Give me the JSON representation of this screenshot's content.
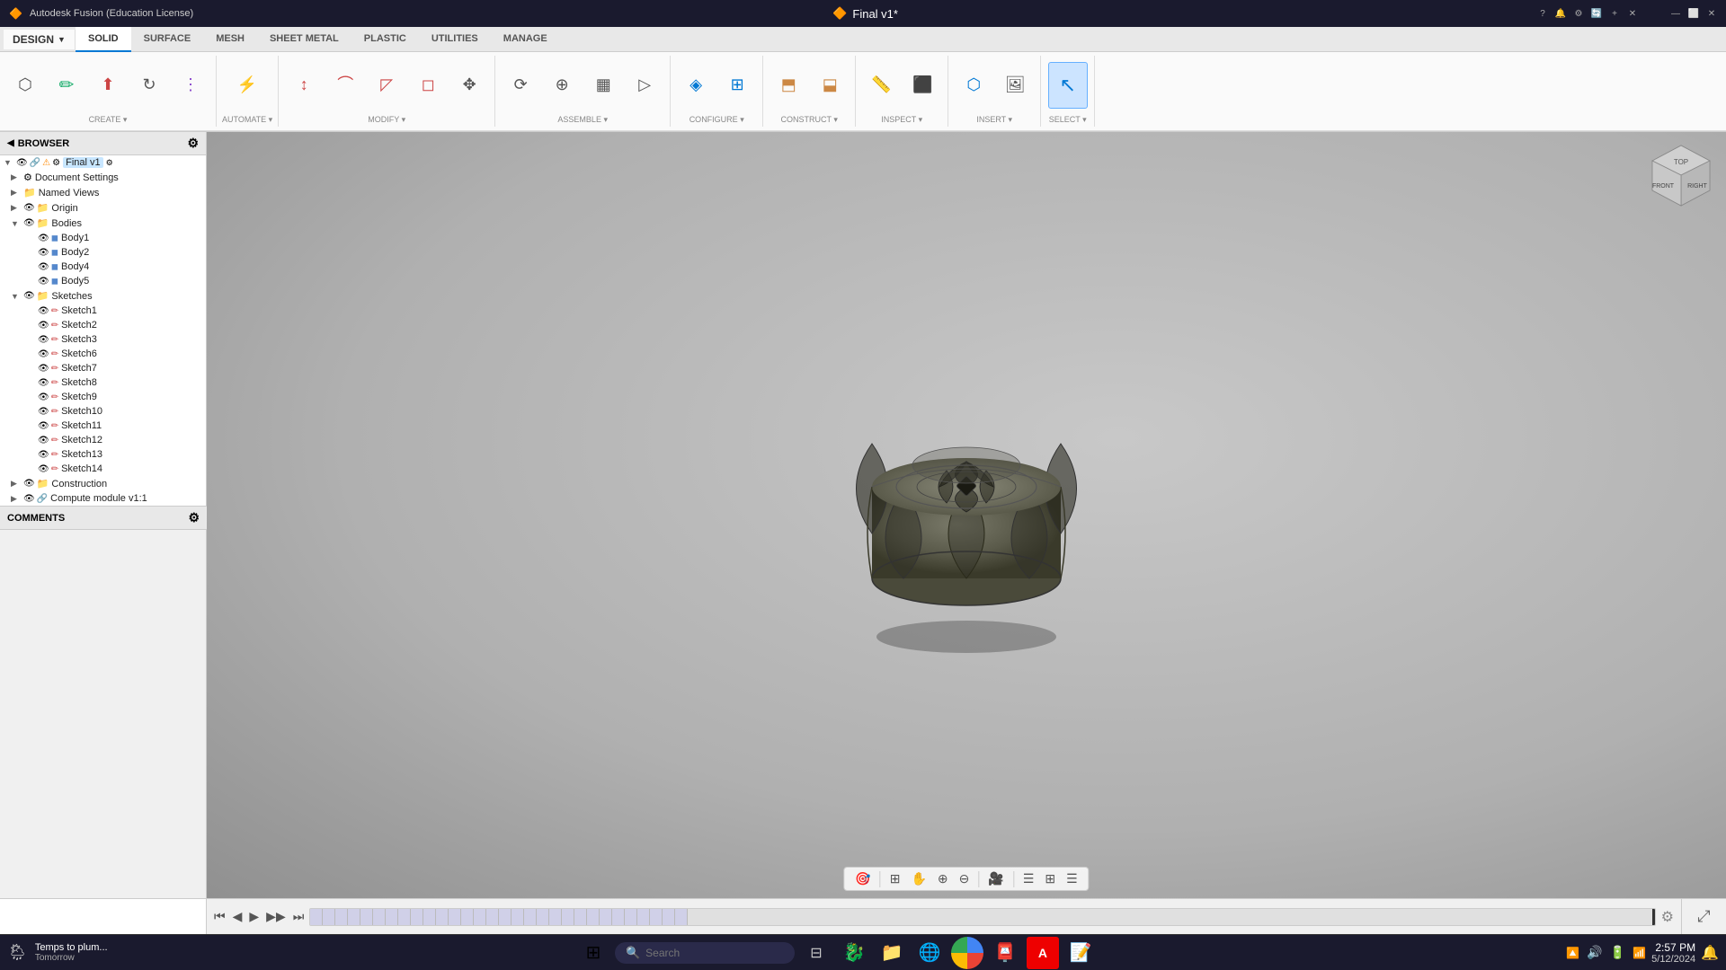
{
  "app": {
    "title": "Autodesk Fusion (Education License)",
    "file_title": "Final v1*"
  },
  "titlebar": {
    "app_icon": "🔶",
    "title": "Autodesk Fusion (Education License)",
    "file_label": "Final v1*",
    "minimize": "—",
    "restore": "⬜",
    "close": "✕"
  },
  "ribbon_tabs": [
    {
      "id": "solid",
      "label": "SOLID",
      "active": true
    },
    {
      "id": "surface",
      "label": "SURFACE"
    },
    {
      "id": "mesh",
      "label": "MESH"
    },
    {
      "id": "sheetmetal",
      "label": "SHEET METAL"
    },
    {
      "id": "plastic",
      "label": "PLASTIC"
    },
    {
      "id": "utilities",
      "label": "UTILITIES"
    },
    {
      "id": "manage",
      "label": "MANAGE"
    }
  ],
  "design_label": "DESIGN",
  "toolbar_groups": [
    {
      "id": "create",
      "label": "CREATE",
      "buttons": [
        {
          "id": "new-component",
          "icon": "⬡",
          "label": ""
        },
        {
          "id": "create-sketch",
          "icon": "✏",
          "label": ""
        },
        {
          "id": "extrude",
          "icon": "⬆",
          "label": ""
        },
        {
          "id": "revolve",
          "icon": "↻",
          "label": ""
        },
        {
          "id": "pattern",
          "icon": "⋮",
          "label": ""
        }
      ]
    },
    {
      "id": "automate",
      "label": "AUTOMATE",
      "buttons": [
        {
          "id": "automate-btn",
          "icon": "⚡",
          "label": ""
        }
      ]
    },
    {
      "id": "modify",
      "label": "MODIFY",
      "buttons": [
        {
          "id": "press-pull",
          "icon": "↕",
          "label": ""
        },
        {
          "id": "fillet",
          "icon": "⌒",
          "label": ""
        },
        {
          "id": "chamfer",
          "icon": "◸",
          "label": ""
        },
        {
          "id": "shell",
          "icon": "◻",
          "label": ""
        },
        {
          "id": "move",
          "icon": "✥",
          "label": ""
        }
      ]
    },
    {
      "id": "assemble",
      "label": "ASSEMBLE",
      "buttons": [
        {
          "id": "joint",
          "icon": "⟳",
          "label": ""
        },
        {
          "id": "joint-origin",
          "icon": "⊕",
          "label": ""
        },
        {
          "id": "rigid-group",
          "icon": "▦",
          "label": ""
        },
        {
          "id": "drive-joints",
          "icon": "▷",
          "label": ""
        }
      ]
    },
    {
      "id": "configure",
      "label": "CONFIGURE",
      "buttons": [
        {
          "id": "configure-btn1",
          "icon": "◈",
          "label": ""
        },
        {
          "id": "configure-btn2",
          "icon": "⊞",
          "label": ""
        }
      ]
    },
    {
      "id": "construct",
      "label": "CONSTRUCT",
      "buttons": [
        {
          "id": "offset-plane",
          "icon": "⬒",
          "label": ""
        },
        {
          "id": "midplane",
          "icon": "⬓",
          "label": ""
        }
      ]
    },
    {
      "id": "inspect",
      "label": "INSPECT",
      "buttons": [
        {
          "id": "measure",
          "icon": "📏",
          "label": ""
        },
        {
          "id": "zebra",
          "icon": "⬛",
          "label": ""
        }
      ]
    },
    {
      "id": "insert",
      "label": "INSERT",
      "buttons": [
        {
          "id": "insert-mesh",
          "icon": "⬡",
          "label": ""
        },
        {
          "id": "insert-image",
          "icon": "🖼",
          "label": ""
        }
      ]
    },
    {
      "id": "select",
      "label": "SELECT",
      "buttons": [
        {
          "id": "select-btn",
          "icon": "↖",
          "label": "",
          "active": true
        }
      ]
    }
  ],
  "browser": {
    "title": "BROWSER",
    "items": [
      {
        "id": "root",
        "depth": 0,
        "label": "Final v1",
        "arrow": "▼",
        "icons": [
          "eye",
          "warning",
          "link",
          "gear"
        ],
        "highlight": true
      },
      {
        "id": "doc-settings",
        "depth": 1,
        "label": "Document Settings",
        "arrow": "▶",
        "icons": [
          "play",
          "gear"
        ]
      },
      {
        "id": "named-views",
        "depth": 1,
        "label": "Named Views",
        "arrow": "▶",
        "icons": [
          "play",
          "folder"
        ]
      },
      {
        "id": "origin",
        "depth": 1,
        "label": "Origin",
        "arrow": "▶",
        "icons": [
          "play",
          "folder",
          "eye"
        ]
      },
      {
        "id": "bodies",
        "depth": 1,
        "label": "Bodies",
        "arrow": "▼",
        "icons": [
          "play",
          "folder",
          "eye"
        ]
      },
      {
        "id": "body1",
        "depth": 2,
        "label": "Body1",
        "icons": [
          "eye",
          "body"
        ]
      },
      {
        "id": "body2",
        "depth": 2,
        "label": "Body2",
        "icons": [
          "eye",
          "body"
        ]
      },
      {
        "id": "body4",
        "depth": 2,
        "label": "Body4",
        "icons": [
          "eye",
          "body"
        ]
      },
      {
        "id": "body5",
        "depth": 2,
        "label": "Body5",
        "icons": [
          "eye",
          "body"
        ]
      },
      {
        "id": "sketches",
        "depth": 1,
        "label": "Sketches",
        "arrow": "▼",
        "icons": [
          "play",
          "folder",
          "eye"
        ]
      },
      {
        "id": "sketch1",
        "depth": 2,
        "label": "Sketch1",
        "icons": [
          "eye",
          "sketch"
        ]
      },
      {
        "id": "sketch2",
        "depth": 2,
        "label": "Sketch2",
        "icons": [
          "eye",
          "sketch"
        ]
      },
      {
        "id": "sketch3",
        "depth": 2,
        "label": "Sketch3",
        "icons": [
          "eye",
          "sketch"
        ]
      },
      {
        "id": "sketch6",
        "depth": 2,
        "label": "Sketch6",
        "icons": [
          "eye",
          "sketch"
        ]
      },
      {
        "id": "sketch7",
        "depth": 2,
        "label": "Sketch7",
        "icons": [
          "eye",
          "sketch"
        ]
      },
      {
        "id": "sketch8",
        "depth": 2,
        "label": "Sketch8",
        "icons": [
          "eye",
          "sketch"
        ]
      },
      {
        "id": "sketch9",
        "depth": 2,
        "label": "Sketch9",
        "icons": [
          "eye",
          "sketch"
        ]
      },
      {
        "id": "sketch10",
        "depth": 2,
        "label": "Sketch10",
        "icons": [
          "eye",
          "sketch"
        ]
      },
      {
        "id": "sketch11",
        "depth": 2,
        "label": "Sketch11",
        "icons": [
          "eye",
          "sketch"
        ]
      },
      {
        "id": "sketch12",
        "depth": 2,
        "label": "Sketch12",
        "icons": [
          "eye",
          "sketch"
        ]
      },
      {
        "id": "sketch13",
        "depth": 2,
        "label": "Sketch13",
        "icons": [
          "eye",
          "sketch"
        ]
      },
      {
        "id": "sketch14",
        "depth": 2,
        "label": "Sketch14",
        "icons": [
          "eye",
          "sketch"
        ]
      },
      {
        "id": "construction",
        "depth": 1,
        "label": "Construction",
        "arrow": "▶",
        "icons": [
          "play",
          "folder",
          "eye"
        ]
      },
      {
        "id": "compute-module",
        "depth": 1,
        "label": "Compute module v1:1",
        "arrow": "▶",
        "icons": [
          "play",
          "eye",
          "link"
        ]
      }
    ]
  },
  "comments": {
    "title": "COMMENTS"
  },
  "viewport": {
    "bg_color": "#c0c0c0"
  },
  "viewcube": {
    "faces": [
      "TOP",
      "FRONT",
      "RIGHT"
    ]
  },
  "viewport_bottom_toolbar": {
    "buttons": [
      "🎯",
      "⊞",
      "✋",
      "⊕",
      "⊖",
      "🎥",
      "☰",
      "⊞",
      "☰"
    ]
  },
  "timeline": {
    "play_buttons": [
      "⏮",
      "◀",
      "▶",
      "▶▶",
      "⏭"
    ],
    "steps_count": 40
  },
  "taskbar": {
    "weather": {
      "icon": "🌦",
      "temp": "Temps to plum...",
      "date": "Tomorrow"
    },
    "search_placeholder": "Search",
    "apps": [
      {
        "id": "start",
        "icon": "⊞",
        "label": "Start"
      },
      {
        "id": "search-app",
        "icon": "🔍",
        "label": "Search"
      },
      {
        "id": "apps-icon",
        "icon": "🐉",
        "label": "Apps"
      },
      {
        "id": "files",
        "icon": "📁",
        "label": "File Explorer"
      },
      {
        "id": "edge",
        "icon": "🌐",
        "label": "Edge"
      },
      {
        "id": "chrome",
        "icon": "🔵",
        "label": "Chrome"
      },
      {
        "id": "mail",
        "icon": "📮",
        "label": "Mail"
      },
      {
        "id": "adobe",
        "icon": "🅰",
        "label": "Adobe"
      },
      {
        "id": "notes",
        "icon": "📝",
        "label": "Notes"
      }
    ],
    "time": "2:57 PM",
    "date_display": "5/12/2024",
    "notif_icons": [
      "🔼",
      "🔊",
      "🔋"
    ]
  }
}
